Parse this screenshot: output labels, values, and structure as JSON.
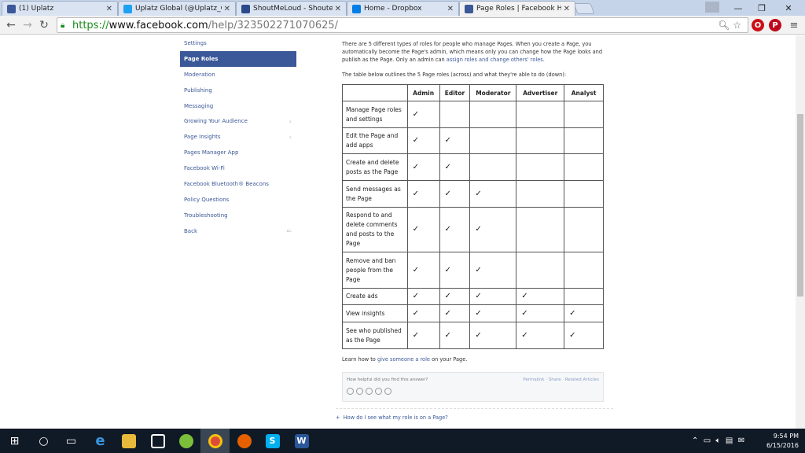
{
  "browser": {
    "tabs": [
      {
        "title": "(1) Uplatz",
        "favicon": "facebook-icon",
        "color": "#3b5998",
        "active": false
      },
      {
        "title": "Uplatz Global (@Uplatz_G",
        "favicon": "twitter-icon",
        "color": "#1da1f2",
        "active": false
      },
      {
        "title": "ShoutMeLoud - Shouter W",
        "favicon": "shoutmeloud-icon",
        "color": "#2b4a8a",
        "active": false
      },
      {
        "title": "Home - Dropbox",
        "favicon": "dropbox-icon",
        "color": "#007ee5",
        "active": false
      },
      {
        "title": "Page Roles | Facebook He",
        "favicon": "facebook-icon",
        "color": "#3b5998",
        "active": true
      }
    ],
    "url": {
      "scheme": "https://",
      "host": "www.facebook.com",
      "path": "/help/323502271070625/"
    }
  },
  "sidebar": {
    "items": [
      {
        "label": "Settings",
        "arrow": ""
      },
      {
        "label": "Page Roles",
        "arrow": "",
        "active": true
      },
      {
        "label": "Moderation",
        "arrow": ""
      },
      {
        "label": "Publishing",
        "arrow": ""
      },
      {
        "label": "Messaging",
        "arrow": ""
      },
      {
        "label": "Growing Your Audience",
        "arrow": "›"
      },
      {
        "label": "Page Insights",
        "arrow": "›"
      },
      {
        "label": "Pages Manager App",
        "arrow": ""
      },
      {
        "label": "Facebook Wi-Fi",
        "arrow": ""
      },
      {
        "label": "Facebook Bluetooth® Beacons",
        "arrow": ""
      },
      {
        "label": "Policy Questions",
        "arrow": ""
      },
      {
        "label": "Troubleshooting",
        "arrow": ""
      },
      {
        "label": "Back",
        "arrow": "⇐"
      }
    ]
  },
  "content": {
    "intro_text": "There are 5 different types of roles for people who manage Pages. When you create a Page, you automatically become the Page's admin, which means only you can change how the Page looks and publish as the Page. Only an admin can ",
    "intro_link": "assign roles and change others' roles",
    "intro_end": ".",
    "table_intro": "The table below outlines the 5 Page roles (across) and what they're able to do (down):",
    "learn_prefix": "Learn how to ",
    "learn_link": "give someone a role",
    "learn_suffix": " on your Page.",
    "helpful_question": "How helpful did you find this answer?",
    "helpful_links": "Permalink · Share · Related Articles",
    "related_question": "How do I see what my role is on a Page?"
  },
  "roles_table": {
    "columns": [
      "",
      "Admin",
      "Editor",
      "Moderator",
      "Advertiser",
      "Analyst"
    ],
    "check": "✓",
    "rows": [
      {
        "label": "Manage Page roles and settings",
        "checks": [
          true,
          false,
          false,
          false,
          false
        ],
        "height": 34
      },
      {
        "label": "Edit the Page and add apps",
        "checks": [
          true,
          true,
          false,
          false,
          false
        ],
        "height": 33
      },
      {
        "label": "Create and delete posts as the Page",
        "checks": [
          true,
          true,
          false,
          false,
          false
        ],
        "height": 34
      },
      {
        "label": "Send messages as the Page",
        "checks": [
          true,
          true,
          true,
          false,
          false
        ],
        "height": 34
      },
      {
        "label": "Respond to and delete comments and posts to the Page",
        "checks": [
          true,
          true,
          true,
          false,
          false
        ],
        "height": 57
      },
      {
        "label": "Remove and ban people from the Page",
        "checks": [
          true,
          true,
          true,
          false,
          false
        ],
        "height": 46
      },
      {
        "label": "Create ads",
        "checks": [
          true,
          true,
          true,
          true,
          false
        ],
        "height": 21
      },
      {
        "label": "View insights",
        "checks": [
          true,
          true,
          true,
          true,
          true
        ],
        "height": 22
      },
      {
        "label": "See who published as the Page",
        "checks": [
          true,
          true,
          true,
          true,
          true
        ],
        "height": 34
      }
    ]
  },
  "taskbar": {
    "time": "9:54 PM",
    "date": "6/15/2016"
  }
}
